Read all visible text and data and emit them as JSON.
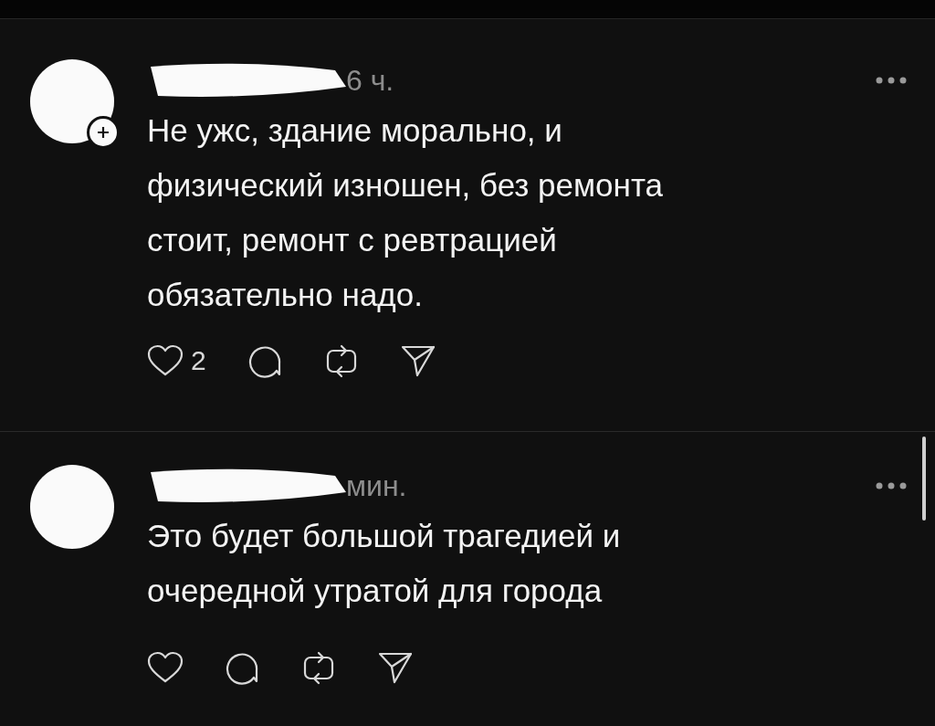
{
  "posts": [
    {
      "time": "6 ч.",
      "follow_badge": true,
      "lines": [
        "Не ужс, здание морально, и",
        "физический изношен, без ремонта",
        "стоит, ремонт с ревтрацией",
        "обязательно надо."
      ],
      "likes": "2"
    },
    {
      "time": "мин.",
      "follow_badge": false,
      "lines": [
        "Это будет большой трагедией и",
        "очередной утратой для города"
      ]
    }
  ]
}
